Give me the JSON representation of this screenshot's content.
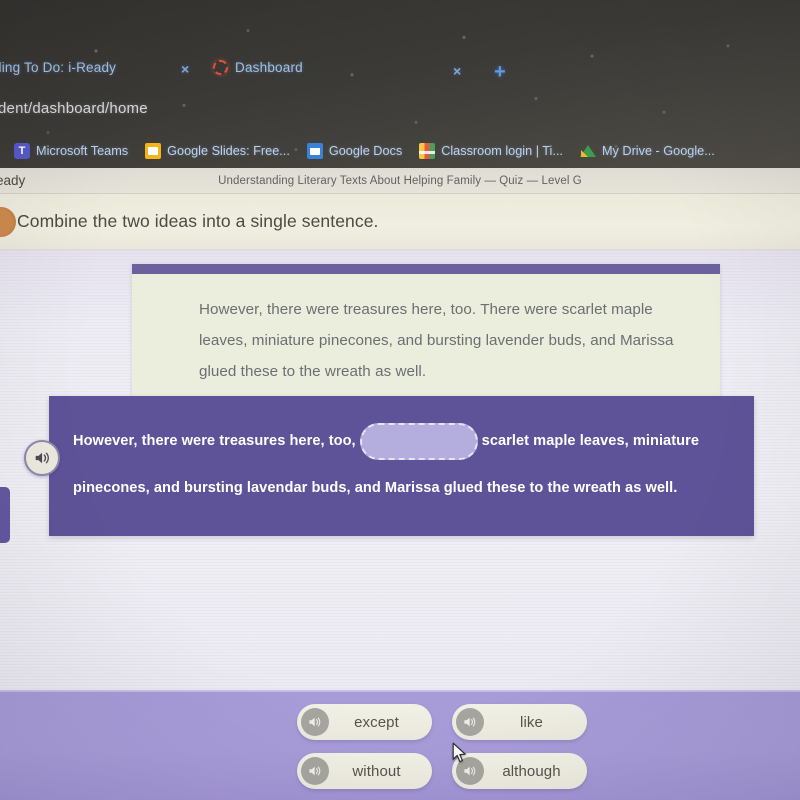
{
  "browser": {
    "tabs": [
      {
        "title": "ding To Do: i-Ready",
        "close_label": "×",
        "favicon": "ireadydashed-icon"
      },
      {
        "title": "Dashboard",
        "close_label": "×",
        "favicon": "ready-ring-icon"
      }
    ],
    "new_tab_label": "+",
    "address": "dent/dashboard/home",
    "bookmarks": [
      {
        "label": "Microsoft Teams",
        "icon": "teams-icon"
      },
      {
        "label": "Google Slides: Free...",
        "icon": "slides-icon"
      },
      {
        "label": "Google Docs",
        "icon": "docs-icon"
      },
      {
        "label": "Classroom login | Ti...",
        "icon": "classroom-icon"
      },
      {
        "label": "My Drive - Google...",
        "icon": "drive-icon"
      }
    ]
  },
  "app": {
    "brand": "eady",
    "lesson_title": "Understanding Literary Texts About Helping Family — Quiz — Level G",
    "question_instruction": "Combine the two ideas into a single sentence."
  },
  "passage": {
    "text": "However, there were treasures here, too. There were scarlet maple leaves, miniature pinecones, and bursting lavender buds, and Marissa glued these to the wreath as well."
  },
  "answer": {
    "text_before_blank": "However, there were treasures here, too,",
    "text_after_blank": "scarlet maple leaves, miniature pinecones, and bursting lavendar buds, and Marissa glued these to the wreath as well.",
    "blank_value": "",
    "speaker_icon": "speaker-icon"
  },
  "options": [
    {
      "label": "except",
      "icon": "speaker-icon"
    },
    {
      "label": "like",
      "icon": "speaker-icon"
    },
    {
      "label": "without",
      "icon": "speaker-icon"
    },
    {
      "label": "although",
      "icon": "speaker-icon"
    }
  ],
  "colors": {
    "answer_card": "#5e5398",
    "passage_card": "#ebeddd",
    "passage_accent": "#6b619f",
    "tray": "#a79bd8",
    "content_bg": "#efeef6",
    "question_badge": "#cf8a4e",
    "chrome": "#3b3a37"
  }
}
